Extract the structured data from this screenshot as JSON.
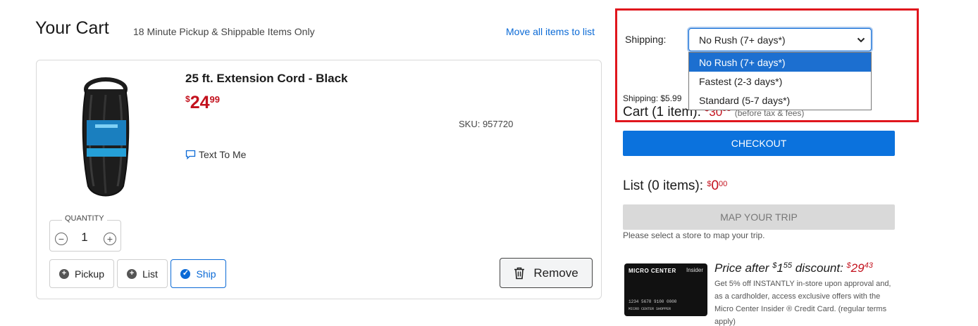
{
  "header": {
    "title": "Your Cart",
    "subtitle": "18 Minute Pickup & Shippable Items Only",
    "move_all": "Move all items to list"
  },
  "item": {
    "name": "25 ft. Extension Cord - Black",
    "price_symbol": "$",
    "price_dollars": "24",
    "price_cents": "99",
    "sku": "SKU: 957720",
    "text_to_me": "Text To Me",
    "quantity_label": "QUANTITY",
    "quantity": "1",
    "fulfillment": {
      "pickup": "Pickup",
      "list": "List",
      "ship": "Ship"
    },
    "remove": "Remove"
  },
  "shipping": {
    "label": "Shipping:",
    "selected": "No Rush (7+ days*)",
    "options": [
      "No Rush (7+ days*)",
      "Fastest (2-3 days*)",
      "Standard (5-7 days*)"
    ],
    "cost": "Shipping: $5.99"
  },
  "cart_summary": {
    "label": "Cart (1 item):",
    "amount_symbol": "$",
    "amount_dollars": "30",
    "amount_cents": "98",
    "note": "(before tax & fees)",
    "checkout": "CHECKOUT"
  },
  "list_summary": {
    "label": "List (0 items):",
    "amount_symbol": "$",
    "amount_dollars": "0",
    "amount_cents": "00",
    "map_button": "MAP YOUR TRIP",
    "map_note": "Please select a store to map your trip."
  },
  "promo": {
    "card_brand": "MICRO CENTER",
    "card_insider": "Insider",
    "card_number": "1234 5678 9100 0000",
    "card_holder": "MICRO CENTER SHOPPER",
    "headline_prefix": "Price after ",
    "discount_symbol": "$",
    "discount_dollars": "1",
    "discount_cents": "55",
    "headline_mid": " discount: ",
    "final_symbol": "$",
    "final_dollars": "29",
    "final_cents": "43",
    "body": "Get 5% off INSTANTLY in-store upon approval and, as a cardholder, access exclusive offers with the Micro Center Insider ® Credit Card. (regular terms apply)"
  },
  "colors": {
    "accent": "#0b6ad6",
    "price": "#c3111d",
    "highlight": "#e0161d"
  }
}
